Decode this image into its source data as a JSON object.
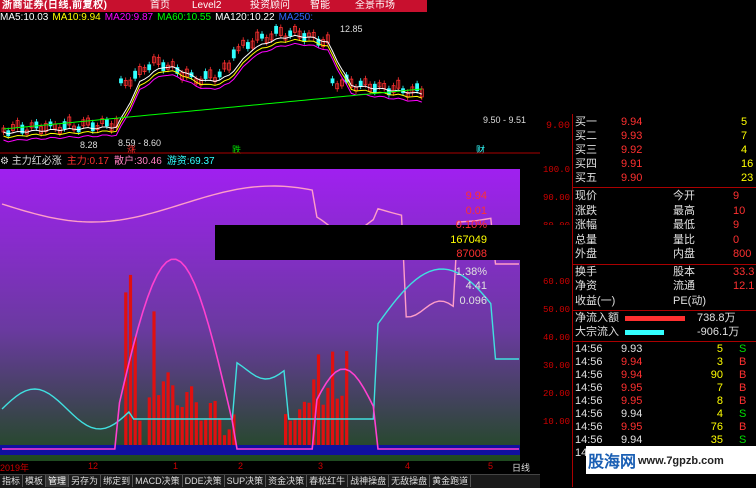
{
  "brand": {
    "logo_text": "浙商证券(日线,前复权)",
    "sub_logo": "CHINA SECURITIES",
    "menu": [
      "首页",
      "Level2",
      "投资顾问",
      "智能",
      "全景市场"
    ]
  },
  "ma_legend": [
    {
      "label": "MA5:",
      "value": "10.03",
      "color": "#ffffff"
    },
    {
      "label": "MA10:",
      "value": "9.94",
      "color": "#ffff00"
    },
    {
      "label": "MA20:",
      "value": "9.87",
      "color": "#ff00ff"
    },
    {
      "label": "MA60:",
      "value": "10.55",
      "color": "#00ff00"
    },
    {
      "label": "MA120:",
      "value": "10.22",
      "color": "#ffffff"
    },
    {
      "label": "MA250:",
      "value": "",
      "color": "#3366ff"
    }
  ],
  "kline": {
    "high_label": "12.85",
    "low_label": "8.28",
    "range_label_1": "8.59 - 8.60",
    "range_label_2": "9.50 - 9.51",
    "axis_label": "9.00",
    "zhang": "涨",
    "die": "跌",
    "cai": "财"
  },
  "indicator": {
    "title": "主力红必涨",
    "items": [
      {
        "label": "主力:",
        "value": "0.17",
        "color": "#ff3030"
      },
      {
        "label": "散户:",
        "value": "30.46",
        "color": "#ff80c0"
      },
      {
        "label": "游资:",
        "value": "69.37",
        "color": "#3ff"
      }
    ],
    "axis": [
      "100.0",
      "90.00",
      "80.00",
      "70.00",
      "60.00",
      "50.00",
      "40.00",
      "30.00",
      "20.00",
      "10.00"
    ]
  },
  "date_axis": [
    "2019年",
    "12",
    "1",
    "2",
    "3",
    "4",
    "5",
    "日线"
  ],
  "tabs": [
    "指标",
    "模板",
    "管理",
    "另存为",
    "绑定到",
    "MACD决策",
    "DDE决策",
    "SUP决策",
    "资金决策",
    "春松红牛",
    "战神操盘",
    "无敌操盘",
    "黄金跑道"
  ],
  "active_tab": "管理",
  "order_book": [
    {
      "label": "买一",
      "price": "9.94",
      "vol": "5"
    },
    {
      "label": "买二",
      "price": "9.93",
      "vol": "7"
    },
    {
      "label": "买三",
      "price": "9.92",
      "vol": "4"
    },
    {
      "label": "买四",
      "price": "9.91",
      "vol": "16"
    },
    {
      "label": "买五",
      "price": "9.90",
      "vol": "23"
    }
  ],
  "stats": [
    {
      "l1": "现价",
      "v1": "9.94",
      "c1": "#ff3030",
      "l2": "今开",
      "v2": "9"
    },
    {
      "l1": "涨跌",
      "v1": "0.01",
      "c1": "#ff3030",
      "l2": "最高",
      "v2": "10"
    },
    {
      "l1": "涨幅",
      "v1": "0.10%",
      "c1": "#ff3030",
      "l2": "最低",
      "v2": "9"
    },
    {
      "l1": "总量",
      "v1": "167049",
      "c1": "#ffff00",
      "l2": "量比",
      "v2": "0"
    },
    {
      "l1": "外盘",
      "v1": "87008",
      "c1": "#ff3030",
      "l2": "内盘",
      "v2": "800"
    }
  ],
  "stats2": [
    {
      "l1": "换手",
      "v1": "1.38%",
      "c1": "#e0e0e0",
      "l2": "股本",
      "v2": "33.3"
    },
    {
      "l1": "净资",
      "v1": "4.41",
      "c1": "#e0e0e0",
      "l2": "流通",
      "v2": "12.1"
    },
    {
      "l1": "收益(一)",
      "v1": "0.096",
      "c1": "#e0e0e0",
      "l2": "PE(动)",
      "v2": ""
    }
  ],
  "flow": [
    {
      "label": "净流入额",
      "value": "738.8万",
      "color": "#ff3030",
      "bar": 0.85
    },
    {
      "label": "大宗流入",
      "value": "-906.1万",
      "color": "#3ff",
      "bar": 0.55
    }
  ],
  "ticks": [
    {
      "time": "14:56",
      "price": "9.93",
      "vol": "5",
      "side": "S"
    },
    {
      "time": "14:56",
      "price": "9.94",
      "vol": "3",
      "side": "B"
    },
    {
      "time": "14:56",
      "price": "9.94",
      "vol": "90",
      "side": "B"
    },
    {
      "time": "14:56",
      "price": "9.95",
      "vol": "7",
      "side": "B"
    },
    {
      "time": "14:56",
      "price": "9.95",
      "vol": "8",
      "side": "B"
    },
    {
      "time": "14:56",
      "price": "9.94",
      "vol": "4",
      "side": "S"
    },
    {
      "time": "14:56",
      "price": "9.95",
      "vol": "76",
      "side": "B"
    },
    {
      "time": "14:56",
      "price": "9.94",
      "vol": "35",
      "side": "S"
    },
    {
      "time": "14:56",
      "price": "9.95",
      "vol": "100",
      "side": "B"
    }
  ],
  "watermark": {
    "text": "股海网",
    "url_text": "www.7gpzb.com"
  }
}
